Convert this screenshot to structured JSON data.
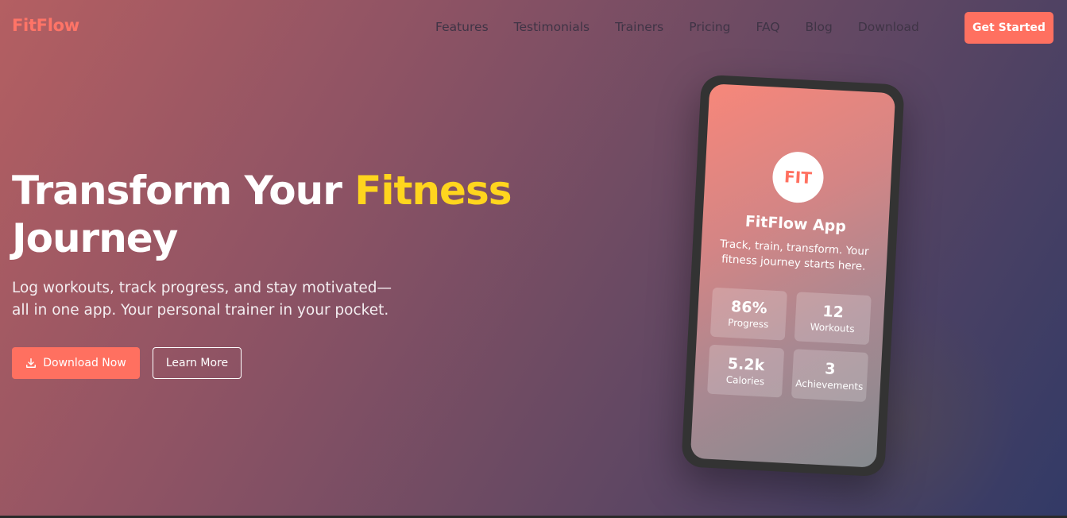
{
  "brand": {
    "name": "FitFlow",
    "accent": "#ff7060",
    "highlight": "#ffd51e"
  },
  "nav": {
    "links": [
      "Features",
      "Testimonials",
      "Trainers",
      "Pricing",
      "FAQ",
      "Blog",
      "Download"
    ],
    "cta_label": "Get Started"
  },
  "hero": {
    "title_part1": "Transform Your ",
    "title_accent": "Fitness",
    "title_part2": "Journey",
    "subtitle_line1": "Log workouts, track progress, and stay motivated—",
    "subtitle_line2": "all in one app. Your personal trainer in your pocket.",
    "primary_button": {
      "label": "Download Now",
      "icon": "download-icon"
    },
    "secondary_button": {
      "label": "Learn More"
    }
  },
  "phone": {
    "logo_text": "FIT",
    "app_title": "FitFlow App",
    "description": "Track, train, transform. Your fitness journey starts here.",
    "stats": [
      {
        "value": "86%",
        "label": "Progress"
      },
      {
        "value": "12",
        "label": "Workouts"
      },
      {
        "value": "5.2k",
        "label": "Calories"
      },
      {
        "value": "3",
        "label": "Achievements"
      }
    ]
  }
}
